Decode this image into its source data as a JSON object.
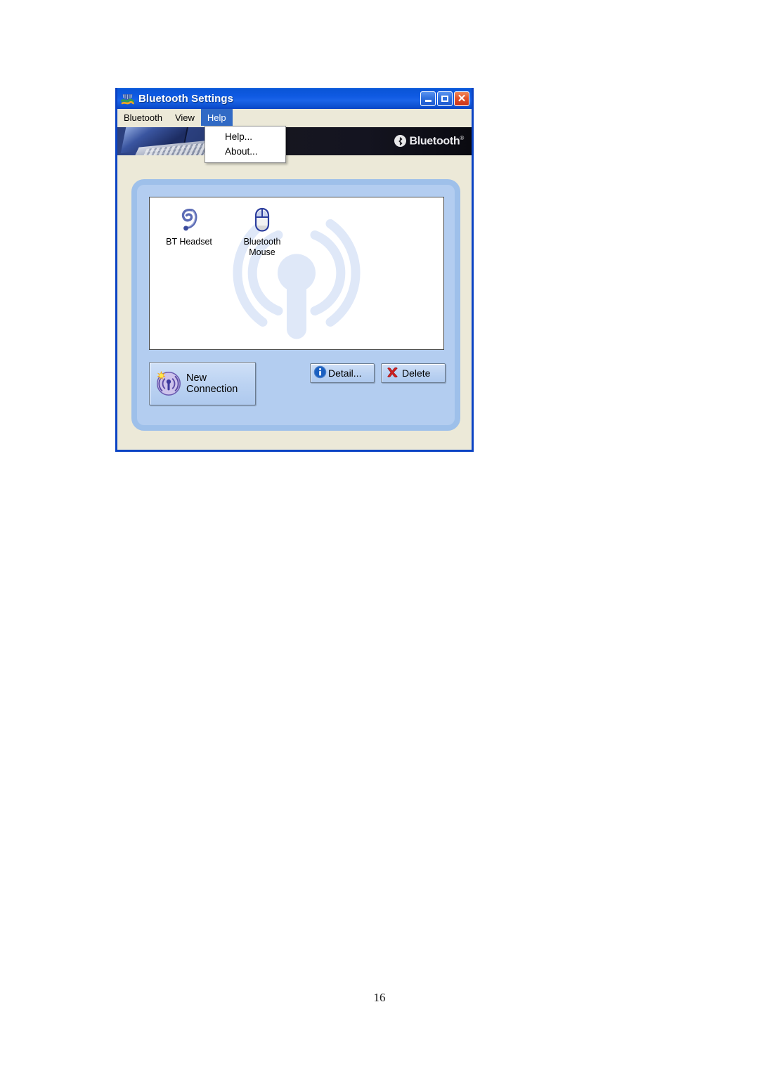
{
  "page": {
    "number": "16"
  },
  "window": {
    "title": "Bluetooth Settings",
    "title_icon": "bluetooth-app-icon",
    "controls": {
      "minimize": "Minimize",
      "maximize": "Maximize",
      "close": "Close"
    }
  },
  "menubar": {
    "items": [
      {
        "label": "Bluetooth",
        "active": false
      },
      {
        "label": "View",
        "active": false
      },
      {
        "label": "Help",
        "active": true
      }
    ]
  },
  "dropdown": {
    "open_for": "Help",
    "items": [
      {
        "label": "Help..."
      },
      {
        "label": "About..."
      }
    ]
  },
  "banner": {
    "photo_alt": "laptop-photo",
    "logo_text": "Bluetooth",
    "logo_registered": "®",
    "logo_icon": "bluetooth-rune-icon"
  },
  "device_list": {
    "watermark_icon": "antenna-signal-watermark",
    "devices": [
      {
        "name": "BT Headset",
        "icon": "headset-icon"
      },
      {
        "name": "Bluetooth\nMouse",
        "name_line1": "Bluetooth",
        "name_line2": "Mouse",
        "icon": "mouse-icon"
      }
    ]
  },
  "buttons": {
    "new_connection": {
      "line1": "New",
      "line2": "Connection",
      "icon": "new-connection-antenna-icon"
    },
    "detail": {
      "label": "Detail...",
      "icon": "info-icon"
    },
    "delete": {
      "label": "Delete",
      "icon": "red-x-icon"
    }
  },
  "colors": {
    "titlebar_blue": "#0b43c4",
    "window_face": "#ece9d8",
    "panel_blue": "#b3cdf0",
    "panel_border": "#9ec0ea",
    "menu_highlight": "#316ac5",
    "close_red": "#c8321a",
    "watermark_blue": "#dfe8f8",
    "delete_x_red": "#d32020",
    "info_blue": "#1a5fc0"
  }
}
